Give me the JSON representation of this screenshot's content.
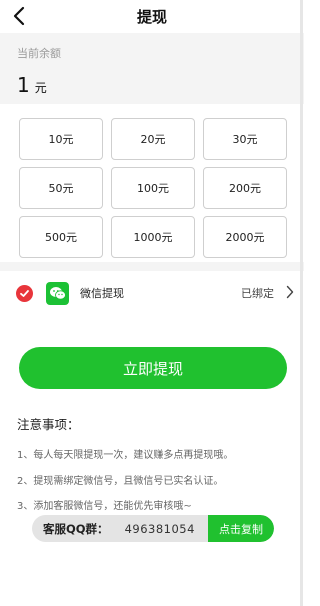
{
  "header": {
    "title": "提现"
  },
  "balance": {
    "label": "当前余额",
    "amount": "1",
    "unit": "元"
  },
  "amounts": [
    "10元",
    "20元",
    "30元",
    "50元",
    "100元",
    "200元",
    "500元",
    "1000元",
    "2000元"
  ],
  "method": {
    "name": "微信提现",
    "status": "已绑定"
  },
  "withdraw_button": "立即提现",
  "notes": {
    "title": "注意事项：",
    "items": [
      "1、每人每天限提现一次，建议赚多点再提现哦。",
      "2、提现需绑定微信号，且微信号已实名认证。",
      "3、添加客服微信号，还能优先审核哦~"
    ]
  },
  "support": {
    "label": "客服QQ群：",
    "number": "496381054",
    "copy_label": "点击复制"
  },
  "colors": {
    "accent_green": "#20c12f",
    "check_red": "#e8353b",
    "wechat_green": "#1cc135"
  },
  "icons": {
    "back": "chevron-left-icon",
    "check": "check-circle-icon",
    "wechat": "wechat-icon",
    "arrow": "chevron-right-icon"
  }
}
